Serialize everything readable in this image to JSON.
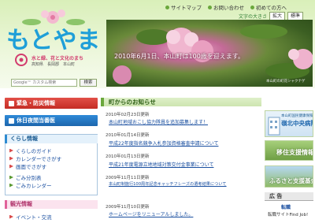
{
  "header": {
    "nav": [
      {
        "label": "サイトマップ"
      },
      {
        "label": "お問い合わせ"
      },
      {
        "label": "初めての方へ"
      }
    ],
    "text_size_label": "文字の大きさ",
    "text_size_buttons": [
      "拡大",
      "標準"
    ],
    "logo": "もとやま",
    "tagline": "水と緑、花と文化のまち",
    "sub_tagline": "高知県　長岡郡　本山町",
    "search_placeholder": "Google™ カスタム検索",
    "search_button": "検索",
    "photo_text": "2010年6月1日、本山町は100歳を迎えます。",
    "photo_caption": "本山町の町花シャクナゲ"
  },
  "left": {
    "emergency": "緊急・防災情報",
    "holiday": "休日夜間当番医",
    "kurashi_title": "くらし情報",
    "kurashi_links": [
      "くらしのガイド",
      "カレンダーでさがす",
      "画面でさがす",
      "ごみ分別表",
      "ごみカレンダー"
    ],
    "kanko_title": "観光情報",
    "kanko_links": [
      "イベント・交流"
    ]
  },
  "news": {
    "title": "町からのお知らせ",
    "items": [
      {
        "date": "2010年02月23日更新",
        "title": "本山町地域おこし協力隊員を追加募集します！"
      },
      {
        "date": "2010年01月14日更新",
        "title": "平成22年度指名競争入札参加資格審査申請について"
      },
      {
        "date": "2010年01月13日更新",
        "title": "平成21年度電源立地地域対策交付金事業について"
      },
      {
        "date": "2009年11月11日更新",
        "title": "本山町制施行100周年記念キャッチフレーズの選考結果について"
      },
      {
        "date": "2009年11月10日更新",
        "title": "ホームページをリニューアルしました。"
      }
    ]
  },
  "right": {
    "hospital_small": "本山町国民健康保険",
    "hospital_big": "嶺北中央病院",
    "iju": "移住支援情報",
    "furusato": "ふるさと支援基金",
    "ad_title": "広 告",
    "ad_line1": "転職",
    "ad_line2": "転職サイトFind Job!"
  }
}
